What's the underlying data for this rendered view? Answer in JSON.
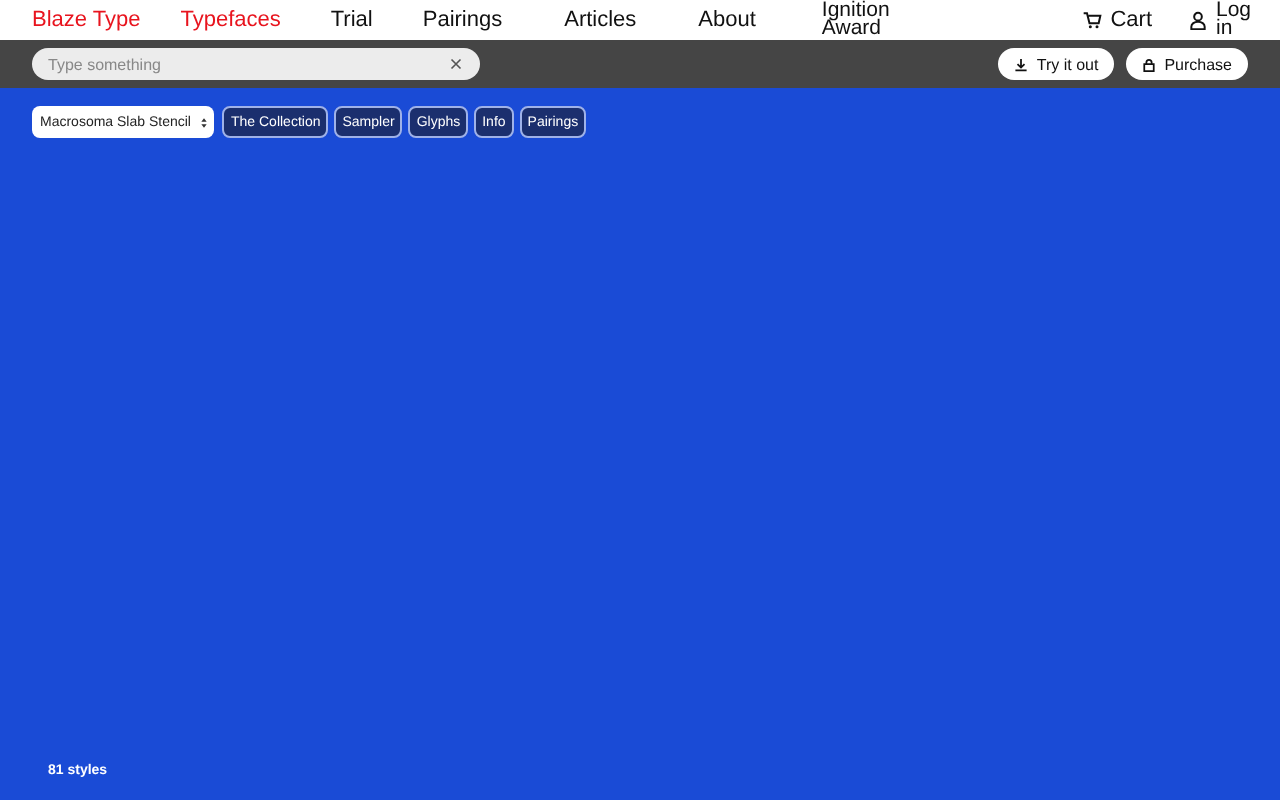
{
  "brand": "Blaze Type",
  "nav": [
    {
      "label": "Typefaces",
      "selected": true
    },
    {
      "label": "Trial",
      "selected": false
    },
    {
      "label": "Pairings",
      "selected": false
    },
    {
      "label": "Articles",
      "selected": false
    },
    {
      "label": "About",
      "selected": false
    },
    {
      "label": "Ignition Award",
      "selected": false
    }
  ],
  "cart": "Cart",
  "login": "Log in",
  "search": {
    "placeholder": "Type something"
  },
  "actions": [
    {
      "label": "Try it out",
      "kind": "download"
    },
    {
      "label": "Purchase",
      "kind": "lock"
    }
  ],
  "font_select": "Macrosoma Slab Stencil",
  "tabs": [
    "The Collection",
    "Sampler",
    "Glyphs",
    "Info",
    "Pairings"
  ],
  "styles_count": "81 styles"
}
